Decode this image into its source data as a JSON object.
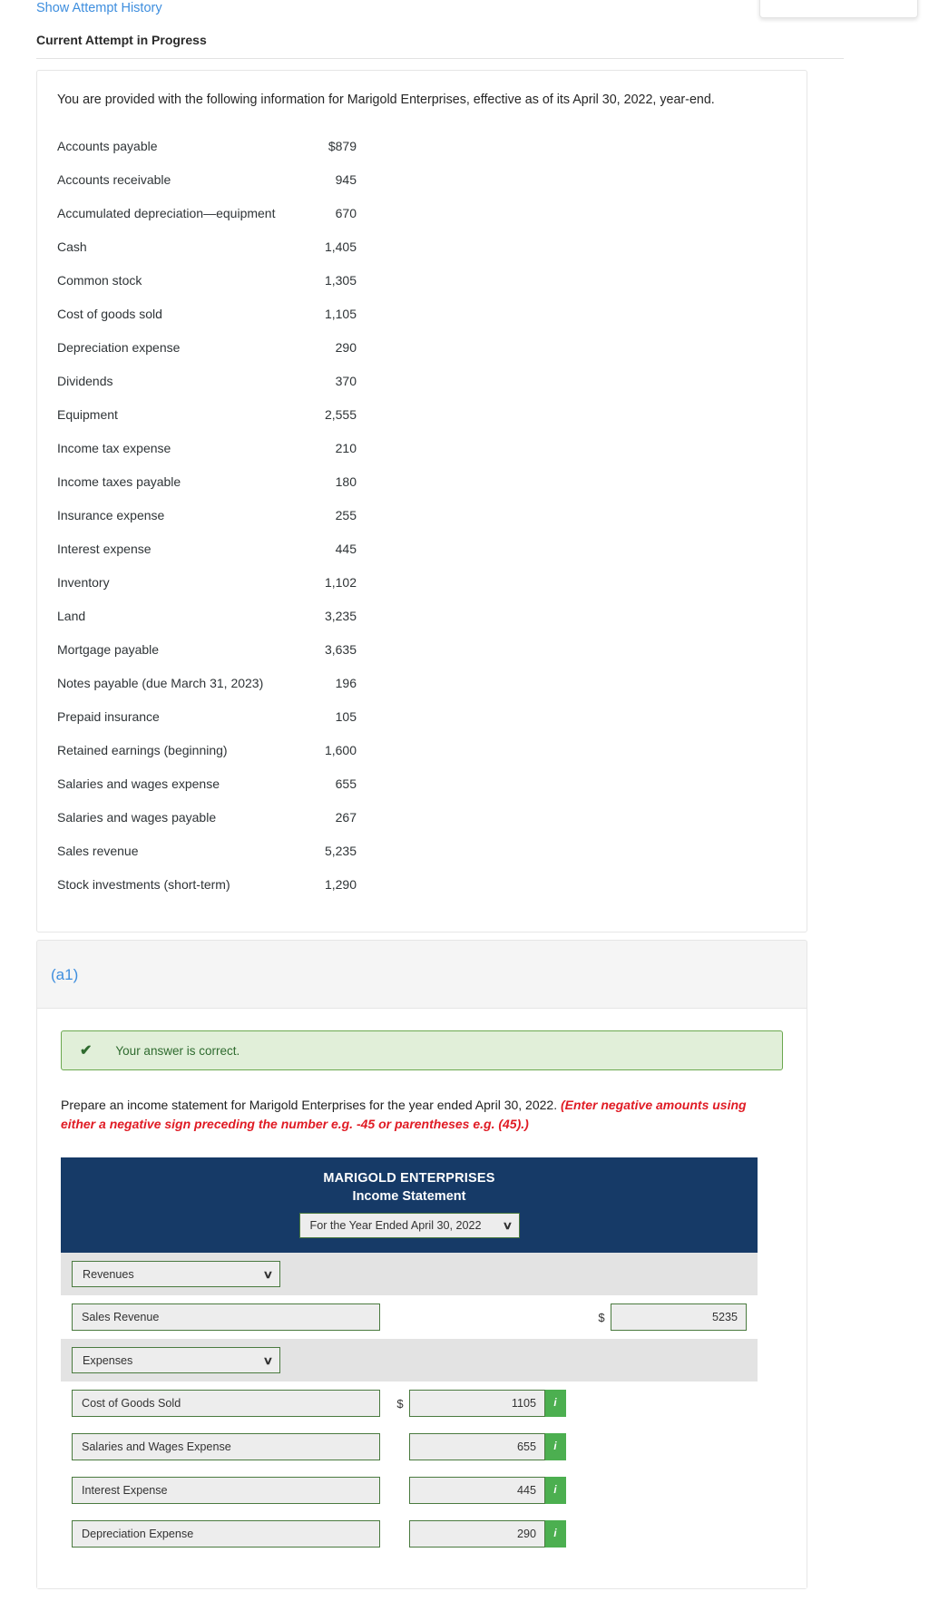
{
  "top": {
    "attempt_history_link": "Show Attempt History",
    "current_attempt": "Current Attempt in Progress"
  },
  "info_card": {
    "intro": "You are provided with the following information for Marigold Enterprises, effective as of its April 30, 2022, year-end.",
    "accounts": [
      {
        "name": "Accounts payable",
        "value": "$879"
      },
      {
        "name": "Accounts receivable",
        "value": "945"
      },
      {
        "name": "Accumulated depreciation—equipment",
        "value": "670"
      },
      {
        "name": "Cash",
        "value": "1,405"
      },
      {
        "name": "Common stock",
        "value": "1,305"
      },
      {
        "name": "Cost of goods sold",
        "value": "1,105"
      },
      {
        "name": "Depreciation expense",
        "value": "290"
      },
      {
        "name": "Dividends",
        "value": "370"
      },
      {
        "name": "Equipment",
        "value": "2,555"
      },
      {
        "name": "Income tax expense",
        "value": "210"
      },
      {
        "name": "Income taxes payable",
        "value": "180"
      },
      {
        "name": "Insurance expense",
        "value": "255"
      },
      {
        "name": "Interest expense",
        "value": "445"
      },
      {
        "name": "Inventory",
        "value": "1,102"
      },
      {
        "name": "Land",
        "value": "3,235"
      },
      {
        "name": "Mortgage payable",
        "value": "3,635"
      },
      {
        "name": "Notes payable (due March 31, 2023)",
        "value": "196"
      },
      {
        "name": "Prepaid insurance",
        "value": "105"
      },
      {
        "name": "Retained earnings (beginning)",
        "value": "1,600"
      },
      {
        "name": "Salaries and wages expense",
        "value": "655"
      },
      {
        "name": "Salaries and wages payable",
        "value": "267"
      },
      {
        "name": "Sales revenue",
        "value": "5,235"
      },
      {
        "name": "Stock investments (short-term)",
        "value": "1,290"
      }
    ]
  },
  "question": {
    "label": "(a1)",
    "feedback": "Your answer is correct.",
    "check_icon": "✔",
    "prompt_main": "Prepare an income statement for Marigold Enterprises for the year ended April 30, 2022. ",
    "prompt_note": "(Enter negative amounts using either a negative sign preceding the number e.g. -45 or parentheses e.g. (45).)"
  },
  "statement": {
    "company": "MARIGOLD ENTERPRISES",
    "title": "Income Statement",
    "period_select": "For the Year Ended April 30, 2022",
    "chevron": "∨",
    "dollar_sign": "$",
    "info_icon": "i",
    "sections": [
      {
        "type": "group",
        "label": "Revenues"
      },
      {
        "type": "line",
        "account": "Sales Revenue",
        "dollar": true,
        "amount": "5235",
        "info": false
      },
      {
        "type": "group",
        "label": "Expenses"
      },
      {
        "type": "line",
        "account": "Cost of Goods Sold",
        "dollar": true,
        "amount": "1105",
        "info": true
      },
      {
        "type": "line",
        "account": "Salaries and Wages Expense",
        "dollar": false,
        "amount": "655",
        "info": true
      },
      {
        "type": "line",
        "account": "Interest Expense",
        "dollar": false,
        "amount": "445",
        "info": true
      },
      {
        "type": "line",
        "account": "Depreciation Expense",
        "dollar": false,
        "amount": "290",
        "info": true
      }
    ]
  },
  "colors": {
    "header_blue": "#163a67",
    "info_green": "#4caf50",
    "border_green": "#4a7a3f",
    "link_blue": "#3e8ede",
    "note_red": "#e01b24",
    "success_bg": "#e1efd9",
    "success_fg": "#2f6b2f"
  }
}
